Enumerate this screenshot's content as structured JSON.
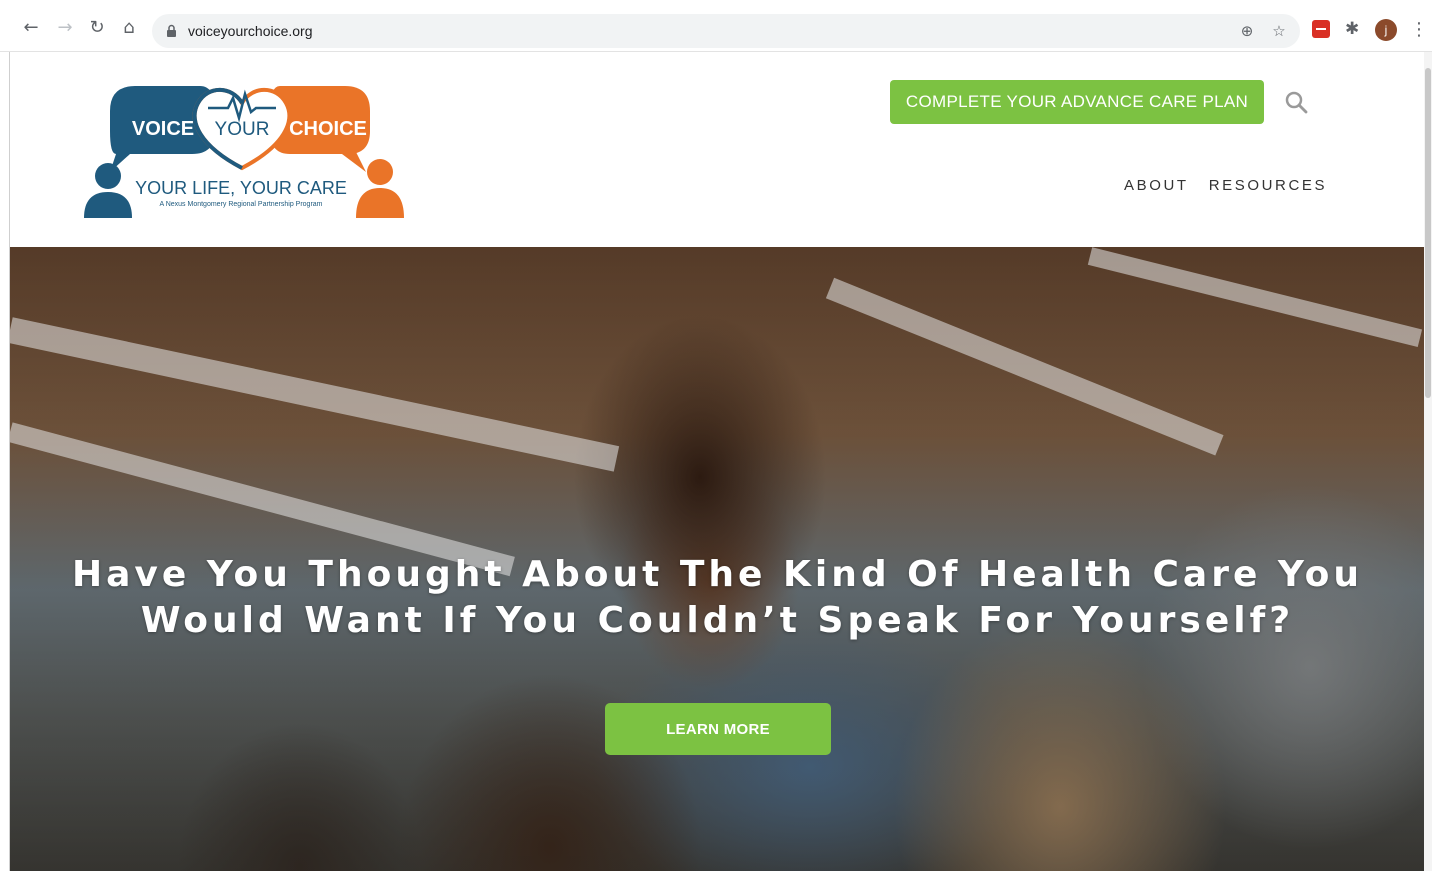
{
  "browser": {
    "url": "voiceyourchoice.org",
    "avatar_initial": "j"
  },
  "logo": {
    "word_left": "VOICE",
    "word_center": "YOUR",
    "word_right": "CHOICE",
    "tagline": "YOUR LIFE, YOUR CARE",
    "subtagline": "A Nexus Montgomery Regional Partnership Program"
  },
  "header": {
    "cta_label": "COMPLETE YOUR ADVANCE CARE PLAN",
    "nav": [
      "ABOUT",
      "RESOURCES"
    ]
  },
  "hero": {
    "title_line1": "Have You Thought About The Kind Of Health Care You",
    "title_line2": "Would Want If You Couldn’t Speak For Yourself?",
    "button_label": "LEARN MORE"
  },
  "colors": {
    "brand_blue": "#1f5a7e",
    "brand_orange": "#ea7428",
    "brand_green": "#7cc242"
  }
}
